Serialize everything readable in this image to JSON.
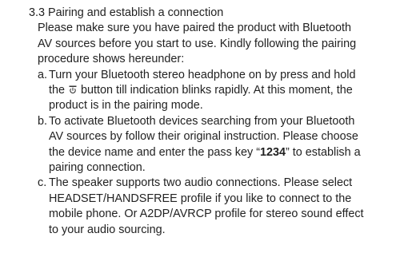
{
  "section": {
    "heading": "3.3 Pairing and establish a connection",
    "intro_lines": [
      "Please make sure you have paired the product with Bluetooth",
      "AV sources before you start to use.  Kindly following the pairing",
      "procedure shows hereunder:"
    ],
    "items": [
      {
        "marker": "a.",
        "l1": "Turn your Bluetooth stereo headphone on by press and hold",
        "l2a": "the",
        "l2b": "button till indication blinks rapidly.  At this moment, the",
        "l3": "product is in the pairing mode."
      },
      {
        "marker": "b.",
        "l1": "To activate Bluetooth devices searching from your Bluetooth",
        "l2": "AV sources by follow their original instruction. Please choose",
        "l3a": "the device name and enter the pass key “",
        "pass_key": "1234",
        "l3b": "” to establish a",
        "l4": "pairing connection."
      },
      {
        "marker": "c.",
        "l1": "The speaker supports two audio connections.  Please select",
        "l2": "HEADSET/HANDSFREE profile if you like to connect to the",
        "l3": "mobile phone.  Or A2DP/AVRCP profile for stereo sound effect",
        "l4": "to your audio sourcing."
      }
    ]
  },
  "icons": {
    "power_button": "power-button-icon"
  },
  "colors": {
    "text": "#222222",
    "background": "#ffffff"
  }
}
